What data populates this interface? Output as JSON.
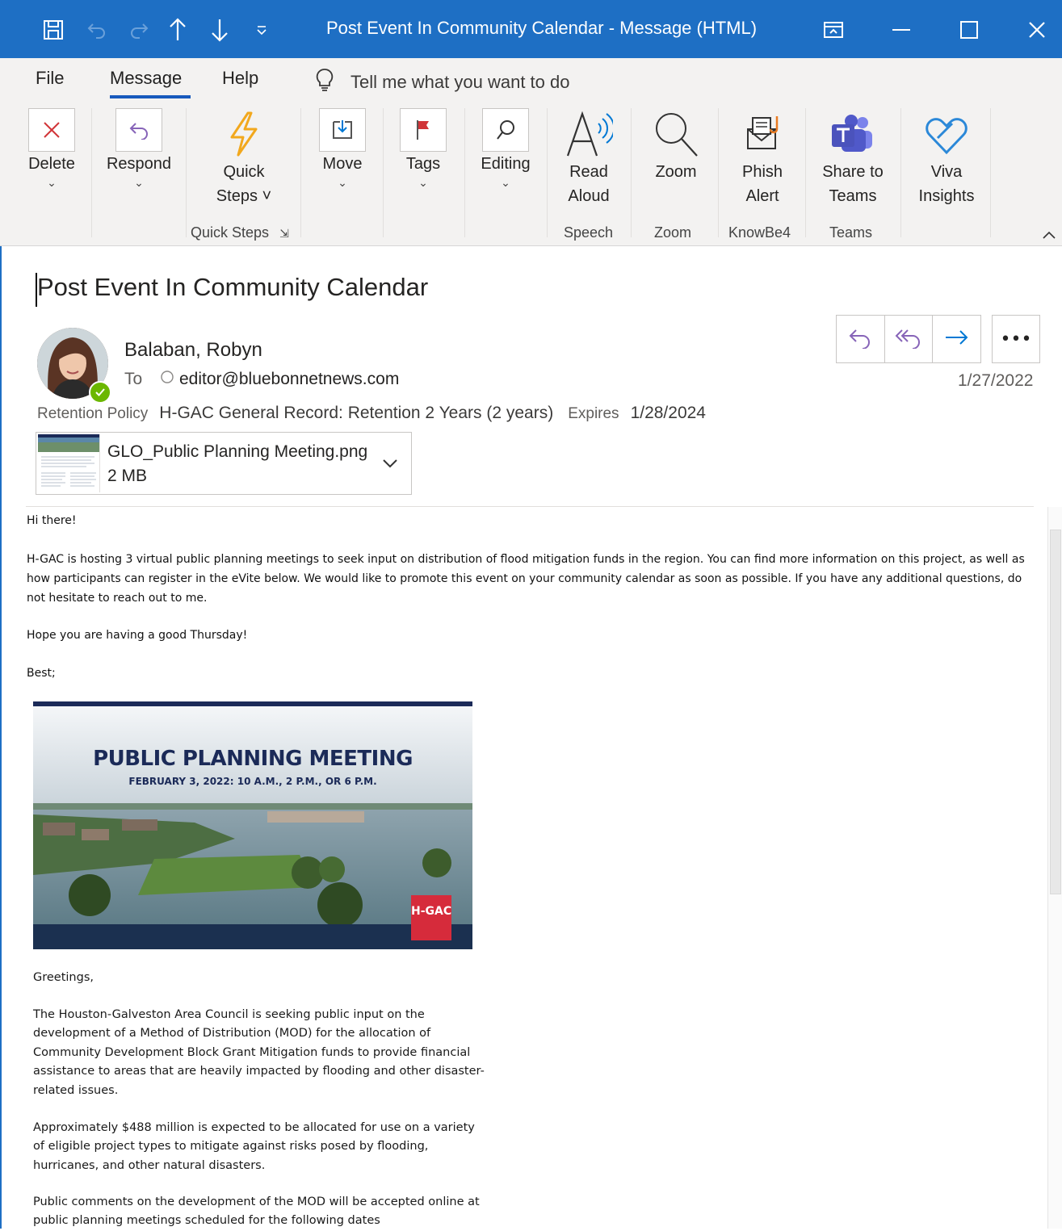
{
  "window": {
    "title": "Post Event In Community Calendar  -  Message (HTML)"
  },
  "tabs": {
    "file": "File",
    "message": "Message",
    "help": "Help",
    "tell_me": "Tell me what you want to do"
  },
  "ribbon": {
    "delete": "Delete",
    "respond": "Respond",
    "quick_steps_1": "Quick",
    "quick_steps_2": "Steps ˅",
    "move": "Move",
    "tags": "Tags",
    "editing": "Editing",
    "read_aloud_1": "Read",
    "read_aloud_2": "Aloud",
    "zoom": "Zoom",
    "phish_1": "Phish",
    "phish_2": "Alert",
    "teams_1": "Share to",
    "teams_2": "Teams",
    "viva_1": "Viva",
    "viva_2": "Insights",
    "groups": {
      "quick_steps": "Quick Steps",
      "speech": "Speech",
      "zoom": "Zoom",
      "knowbe4": "KnowBe4",
      "teams": "Teams"
    }
  },
  "message": {
    "subject": "Post Event In Community Calendar",
    "sender": "Balaban, Robyn",
    "to_label": "To",
    "to_address": "editor@bluebonnetnews.com",
    "date": "1/27/2022",
    "retention_label": "Retention Policy",
    "retention_value": "H-GAC General Record: Retention 2 Years (2 years)",
    "expires_label": "Expires",
    "expires_value": "1/28/2024",
    "attachment": {
      "name": "GLO_Public Planning Meeting.png",
      "size": "2 MB"
    }
  },
  "body": {
    "greeting": "Hi there!",
    "para1": "H-GAC is hosting 3 virtual public planning meetings to seek input on distribution of flood mitigation funds in the region. You can find more information on this project, as well as how participants can register in the eVite below. We would like to promote this event on your community calendar as soon as possible. If you have any additional questions, do not hesitate to reach out to me.",
    "para2": "Hope you are having a good Thursday!",
    "signoff": "Best;"
  },
  "newsletter": {
    "banner_title": "PUBLIC PLANNING MEETING",
    "banner_subtitle": "FEBRUARY 3, 2022: 10 A.M., 2 P.M., OR 6 P.M.",
    "logo_text": "H‑GAC",
    "greeting": "Greetings,",
    "para1": "The Houston-Galveston Area Council is seeking public input on the development of a Method of Distribution (MOD) for the allocation of Community Development Block Grant Mitigation funds to provide financial assistance to areas that are heavily impacted by flooding and other disaster-related issues.",
    "para2": "Approximately $488 million is expected to be allocated for use on a variety of eligible project types to mitigate against risks posed by flooding, hurricanes, and other natural disasters.",
    "para3": "Public comments on the development of the MOD will be accepted online at public planning meetings scheduled for the following dates"
  },
  "colors": {
    "titlebar": "#1e6fc4",
    "accent": "#185abd",
    "delete_red": "#d13438",
    "reply_purple": "#8764b8",
    "forward_blue": "#0078d4"
  }
}
